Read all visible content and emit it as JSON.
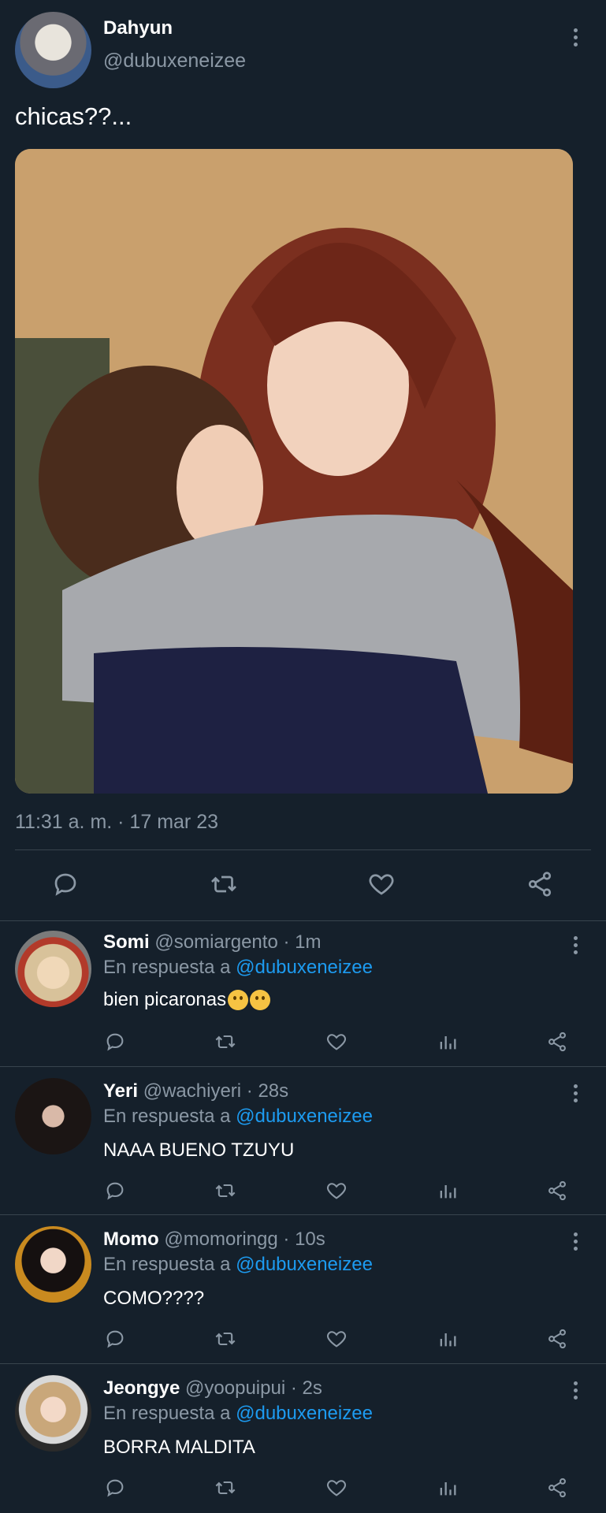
{
  "main_tweet": {
    "name": "Dahyun",
    "handle": "@dubuxeneizee",
    "text": "chicas??...",
    "timestamp": "11:31 a. m. · 17 mar 23"
  },
  "reply_prefix": "En respuesta a",
  "replies": [
    {
      "name": "Somi",
      "handle": "@somiargento",
      "time": "· 1m",
      "reply_to": "@dubuxeneizee",
      "text": "bien picaronas"
    },
    {
      "name": "Yeri",
      "handle": "@wachiyeri",
      "time": "· 28s",
      "reply_to": "@dubuxeneizee",
      "text": "NAAA BUENO TZUYU"
    },
    {
      "name": "Momo",
      "handle": "@momoringg",
      "time": "· 10s",
      "reply_to": "@dubuxeneizee",
      "text": "COMO????"
    },
    {
      "name": "Jeongye",
      "handle": "@yoopuipui",
      "time": "· 2s",
      "reply_to": "@dubuxeneizee",
      "text": "BORRA MALDITA"
    }
  ],
  "icons": {
    "reply": "comment-icon",
    "retweet": "retweet-icon",
    "like": "heart-icon",
    "views": "analytics-icon",
    "share": "share-icon",
    "more": "more-vertical-icon"
  },
  "colors": {
    "background": "#15202b",
    "link": "#1d9bf0",
    "muted": "#8b98a5",
    "divider": "#38444d"
  }
}
